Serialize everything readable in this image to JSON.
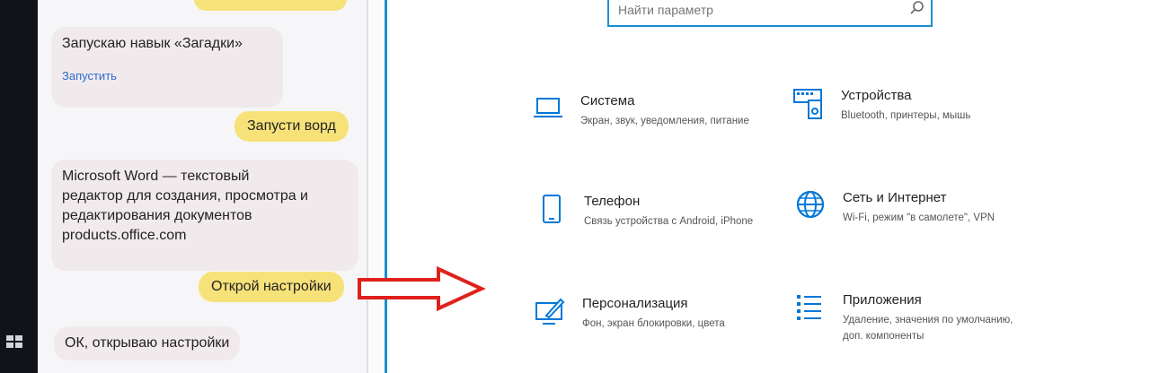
{
  "chat": {
    "messages": [
      {
        "role": "user",
        "text": ""
      },
      {
        "role": "bot",
        "text": "Запускаю навык «Загадки»",
        "link": "Запустить"
      },
      {
        "role": "user",
        "text": "Запусти ворд"
      },
      {
        "role": "bot",
        "lines": [
          "Microsoft Word — текстовый",
          "редактор для создания, просмотра и",
          "редактирования документов",
          "products.office.com"
        ]
      },
      {
        "role": "user",
        "text": "Открой настройки"
      },
      {
        "role": "bot",
        "text": "ОК, открываю настройки"
      }
    ]
  },
  "settings": {
    "search_placeholder": "Найти параметр",
    "tiles": [
      {
        "icon": "laptop-icon",
        "title": "Система",
        "desc": "Экран, звук, уведомления, питание"
      },
      {
        "icon": "devices-icon",
        "title": "Устройства",
        "desc": "Bluetooth, принтеры, мышь"
      },
      {
        "icon": "phone-icon",
        "title": "Телефон",
        "desc": "Связь устройства с Android, iPhone"
      },
      {
        "icon": "globe-icon",
        "title": "Сеть и Интернет",
        "desc": "Wi-Fi, режим \"в самолете\", VPN"
      },
      {
        "icon": "personalization-icon",
        "title": "Персонализация",
        "desc": "Фон, экран блокировки, цвета"
      },
      {
        "icon": "apps-icon",
        "title": "Приложения",
        "desc": "Удаление, значения по умолчанию, доп. компоненты"
      }
    ]
  },
  "colors": {
    "accent": "#0078d7",
    "user_bubble": "#f7e27a",
    "bot_bubble": "#f1eaec",
    "arrow": "#e0201c"
  }
}
